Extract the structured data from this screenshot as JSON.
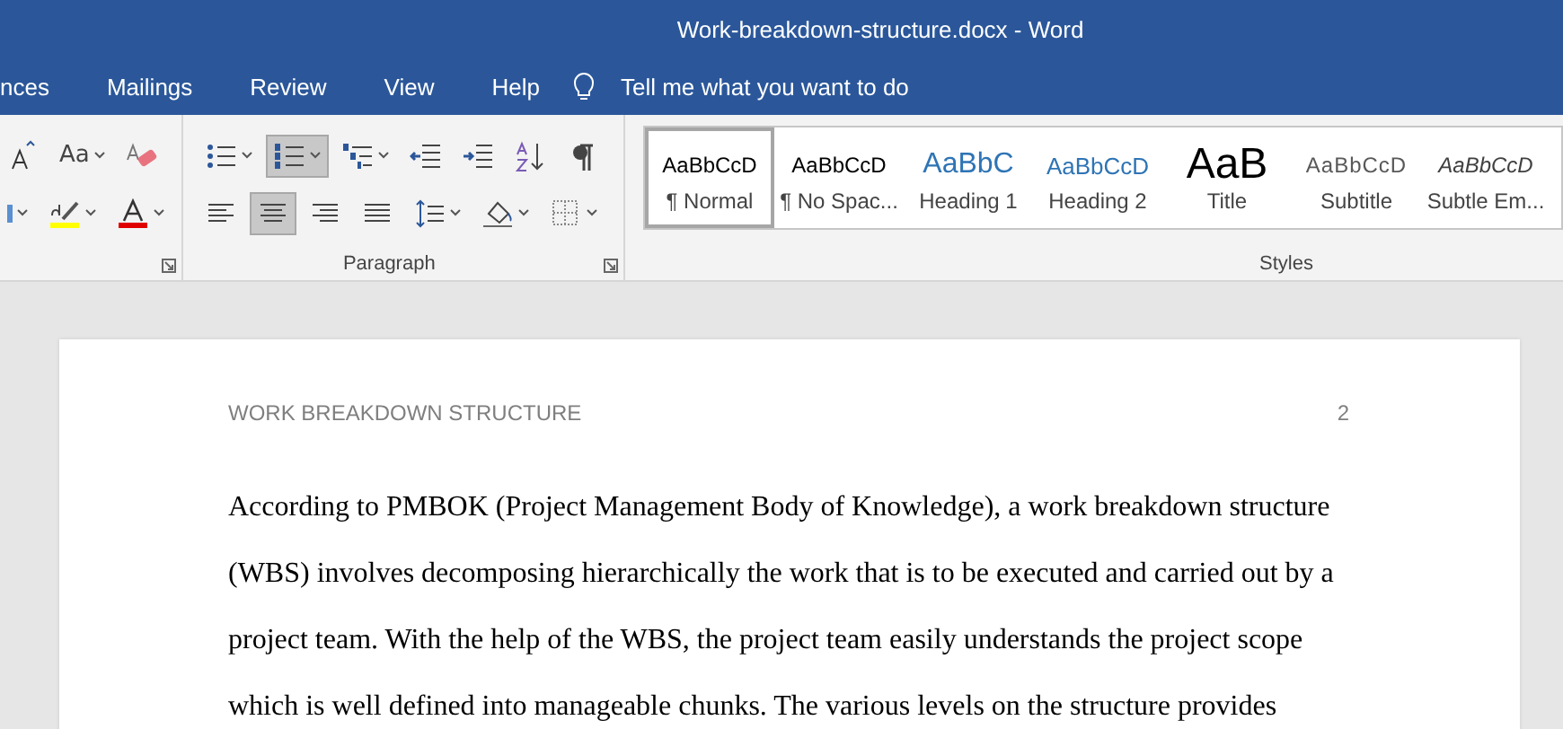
{
  "window": {
    "title": "Work-breakdown-structure.docx  -  Word"
  },
  "tabs": [
    {
      "label": "nces",
      "selected": false
    },
    {
      "label": "Mailings",
      "selected": false
    },
    {
      "label": "Review",
      "selected": false
    },
    {
      "label": "View",
      "selected": false
    },
    {
      "label": "Help",
      "selected": false
    }
  ],
  "tell_me": {
    "placeholder": "Tell me what you want to do"
  },
  "font_group": {
    "row1": [
      {
        "kind": "grow-font",
        "selected": false
      },
      {
        "kind": "change-case",
        "label": "Aa",
        "selected": false
      },
      {
        "kind": "clear-format",
        "selected": false
      }
    ],
    "row2": [
      {
        "kind": "partial",
        "selected": false
      },
      {
        "kind": "highlight",
        "selected": false
      },
      {
        "kind": "font-color",
        "selected": false
      }
    ]
  },
  "paragraph_group": {
    "label": "Paragraph",
    "row1": [
      {
        "kind": "bullets",
        "selected": false
      },
      {
        "kind": "numbering",
        "selected": true
      },
      {
        "kind": "multilevel",
        "selected": false
      },
      {
        "kind": "outdent",
        "selected": false
      },
      {
        "kind": "indent",
        "selected": false
      },
      {
        "kind": "sort",
        "selected": false
      },
      {
        "kind": "pilcrow",
        "selected": false
      }
    ],
    "row2": [
      {
        "kind": "align-left",
        "selected": false
      },
      {
        "kind": "align-center",
        "selected": true
      },
      {
        "kind": "align-right",
        "selected": false
      },
      {
        "kind": "justify",
        "selected": false
      },
      {
        "kind": "line-spacing",
        "selected": false
      },
      {
        "kind": "shading",
        "selected": false
      },
      {
        "kind": "borders",
        "selected": false
      }
    ]
  },
  "styles_group": {
    "label": "Styles",
    "items": [
      {
        "preview": "AaBbCcD",
        "label": "¶ Normal",
        "kind": "normal",
        "selected": true
      },
      {
        "preview": "AaBbCcD",
        "label": "¶ No Spac...",
        "kind": "normal",
        "selected": false
      },
      {
        "preview": "AaBbC",
        "label": "Heading 1",
        "kind": "heading1",
        "selected": false
      },
      {
        "preview": "AaBbCcD",
        "label": "Heading 2",
        "kind": "heading2",
        "selected": false
      },
      {
        "preview": "AaB",
        "label": "Title",
        "kind": "title",
        "selected": false
      },
      {
        "preview": "AaBbCcD",
        "label": "Subtitle",
        "kind": "subtitle",
        "selected": false
      },
      {
        "preview": "AaBbCcD",
        "label": "Subtle Em...",
        "kind": "emphasis",
        "selected": false
      }
    ]
  },
  "document": {
    "header": "WORK BREAKDOWN STRUCTURE",
    "page_number": "2",
    "paragraph": "According to PMBOK (Project Management Body of Knowledge), a work breakdown structure (WBS) involves decomposing hierarchically the work that is to be executed and carried out by a project team. With the help of the WBS, the project team easily understands the project scope which is well defined into manageable chunks. The various levels on the structure provides"
  }
}
